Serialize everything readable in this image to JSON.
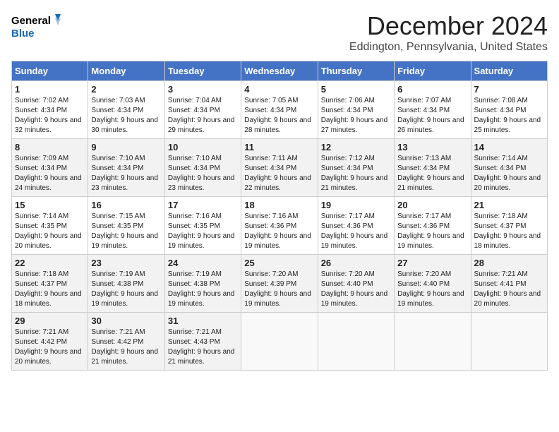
{
  "header": {
    "logo_line1": "General",
    "logo_line2": "Blue",
    "month": "December 2024",
    "location": "Eddington, Pennsylvania, United States"
  },
  "weekdays": [
    "Sunday",
    "Monday",
    "Tuesday",
    "Wednesday",
    "Thursday",
    "Friday",
    "Saturday"
  ],
  "weeks": [
    [
      {
        "day": "1",
        "sunrise": "Sunrise: 7:02 AM",
        "sunset": "Sunset: 4:34 PM",
        "daylight": "Daylight: 9 hours and 32 minutes."
      },
      {
        "day": "2",
        "sunrise": "Sunrise: 7:03 AM",
        "sunset": "Sunset: 4:34 PM",
        "daylight": "Daylight: 9 hours and 30 minutes."
      },
      {
        "day": "3",
        "sunrise": "Sunrise: 7:04 AM",
        "sunset": "Sunset: 4:34 PM",
        "daylight": "Daylight: 9 hours and 29 minutes."
      },
      {
        "day": "4",
        "sunrise": "Sunrise: 7:05 AM",
        "sunset": "Sunset: 4:34 PM",
        "daylight": "Daylight: 9 hours and 28 minutes."
      },
      {
        "day": "5",
        "sunrise": "Sunrise: 7:06 AM",
        "sunset": "Sunset: 4:34 PM",
        "daylight": "Daylight: 9 hours and 27 minutes."
      },
      {
        "day": "6",
        "sunrise": "Sunrise: 7:07 AM",
        "sunset": "Sunset: 4:34 PM",
        "daylight": "Daylight: 9 hours and 26 minutes."
      },
      {
        "day": "7",
        "sunrise": "Sunrise: 7:08 AM",
        "sunset": "Sunset: 4:34 PM",
        "daylight": "Daylight: 9 hours and 25 minutes."
      }
    ],
    [
      {
        "day": "8",
        "sunrise": "Sunrise: 7:09 AM",
        "sunset": "Sunset: 4:34 PM",
        "daylight": "Daylight: 9 hours and 24 minutes."
      },
      {
        "day": "9",
        "sunrise": "Sunrise: 7:10 AM",
        "sunset": "Sunset: 4:34 PM",
        "daylight": "Daylight: 9 hours and 23 minutes."
      },
      {
        "day": "10",
        "sunrise": "Sunrise: 7:10 AM",
        "sunset": "Sunset: 4:34 PM",
        "daylight": "Daylight: 9 hours and 23 minutes."
      },
      {
        "day": "11",
        "sunrise": "Sunrise: 7:11 AM",
        "sunset": "Sunset: 4:34 PM",
        "daylight": "Daylight: 9 hours and 22 minutes."
      },
      {
        "day": "12",
        "sunrise": "Sunrise: 7:12 AM",
        "sunset": "Sunset: 4:34 PM",
        "daylight": "Daylight: 9 hours and 21 minutes."
      },
      {
        "day": "13",
        "sunrise": "Sunrise: 7:13 AM",
        "sunset": "Sunset: 4:34 PM",
        "daylight": "Daylight: 9 hours and 21 minutes."
      },
      {
        "day": "14",
        "sunrise": "Sunrise: 7:14 AM",
        "sunset": "Sunset: 4:34 PM",
        "daylight": "Daylight: 9 hours and 20 minutes."
      }
    ],
    [
      {
        "day": "15",
        "sunrise": "Sunrise: 7:14 AM",
        "sunset": "Sunset: 4:35 PM",
        "daylight": "Daylight: 9 hours and 20 minutes."
      },
      {
        "day": "16",
        "sunrise": "Sunrise: 7:15 AM",
        "sunset": "Sunset: 4:35 PM",
        "daylight": "Daylight: 9 hours and 19 minutes."
      },
      {
        "day": "17",
        "sunrise": "Sunrise: 7:16 AM",
        "sunset": "Sunset: 4:35 PM",
        "daylight": "Daylight: 9 hours and 19 minutes."
      },
      {
        "day": "18",
        "sunrise": "Sunrise: 7:16 AM",
        "sunset": "Sunset: 4:36 PM",
        "daylight": "Daylight: 9 hours and 19 minutes."
      },
      {
        "day": "19",
        "sunrise": "Sunrise: 7:17 AM",
        "sunset": "Sunset: 4:36 PM",
        "daylight": "Daylight: 9 hours and 19 minutes."
      },
      {
        "day": "20",
        "sunrise": "Sunrise: 7:17 AM",
        "sunset": "Sunset: 4:36 PM",
        "daylight": "Daylight: 9 hours and 19 minutes."
      },
      {
        "day": "21",
        "sunrise": "Sunrise: 7:18 AM",
        "sunset": "Sunset: 4:37 PM",
        "daylight": "Daylight: 9 hours and 18 minutes."
      }
    ],
    [
      {
        "day": "22",
        "sunrise": "Sunrise: 7:18 AM",
        "sunset": "Sunset: 4:37 PM",
        "daylight": "Daylight: 9 hours and 18 minutes."
      },
      {
        "day": "23",
        "sunrise": "Sunrise: 7:19 AM",
        "sunset": "Sunset: 4:38 PM",
        "daylight": "Daylight: 9 hours and 19 minutes."
      },
      {
        "day": "24",
        "sunrise": "Sunrise: 7:19 AM",
        "sunset": "Sunset: 4:38 PM",
        "daylight": "Daylight: 9 hours and 19 minutes."
      },
      {
        "day": "25",
        "sunrise": "Sunrise: 7:20 AM",
        "sunset": "Sunset: 4:39 PM",
        "daylight": "Daylight: 9 hours and 19 minutes."
      },
      {
        "day": "26",
        "sunrise": "Sunrise: 7:20 AM",
        "sunset": "Sunset: 4:40 PM",
        "daylight": "Daylight: 9 hours and 19 minutes."
      },
      {
        "day": "27",
        "sunrise": "Sunrise: 7:20 AM",
        "sunset": "Sunset: 4:40 PM",
        "daylight": "Daylight: 9 hours and 19 minutes."
      },
      {
        "day": "28",
        "sunrise": "Sunrise: 7:21 AM",
        "sunset": "Sunset: 4:41 PM",
        "daylight": "Daylight: 9 hours and 20 minutes."
      }
    ],
    [
      {
        "day": "29",
        "sunrise": "Sunrise: 7:21 AM",
        "sunset": "Sunset: 4:42 PM",
        "daylight": "Daylight: 9 hours and 20 minutes."
      },
      {
        "day": "30",
        "sunrise": "Sunrise: 7:21 AM",
        "sunset": "Sunset: 4:42 PM",
        "daylight": "Daylight: 9 hours and 21 minutes."
      },
      {
        "day": "31",
        "sunrise": "Sunrise: 7:21 AM",
        "sunset": "Sunset: 4:43 PM",
        "daylight": "Daylight: 9 hours and 21 minutes."
      },
      null,
      null,
      null,
      null
    ]
  ]
}
